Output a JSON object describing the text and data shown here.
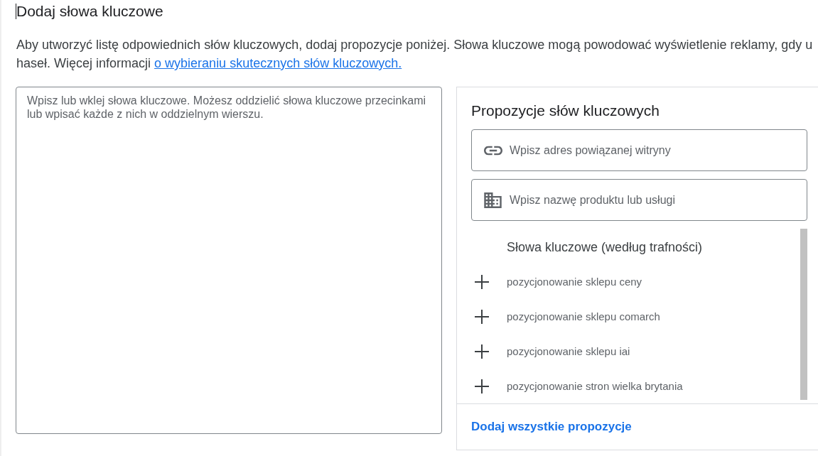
{
  "page": {
    "title": "Dodaj słowa kluczowe",
    "intro": {
      "lines": [
        "Aby utworzyć listę odpowiednich słów kluczowych, dodaj propozycje poniżej. Słowa kluczowe mogą powodować wyświetlenie reklamy, gdy u",
        "haseł. Więcej informacji"
      ],
      "link": "o wybieraniu skutecznych słów kluczowych."
    }
  },
  "keyword_input": {
    "placeholder": "Wpisz lub wklej słowa kluczowe. Możesz oddzielić słowa kluczowe przecinkami lub wpisać każde z nich w oddzielnym wierszu."
  },
  "suggestions": {
    "title": "Propozycje słów kluczowych",
    "fields": [
      {
        "kind": "website",
        "placeholder": "Wpisz adres powiązanej witryny"
      },
      {
        "kind": "product",
        "placeholder": "Wpisz nazwę produktu lub usługi"
      }
    ],
    "list": {
      "heading": "Słowa kluczowe (według trafności)",
      "items": [
        "pozycjonowanie sklepu ceny",
        "pozycjonowanie sklepu comarch",
        "pozycjonowanie sklepu iai",
        "pozycjonowanie stron wielka brytania"
      ]
    },
    "add_all": "Dodaj wszystkie propozycje"
  }
}
